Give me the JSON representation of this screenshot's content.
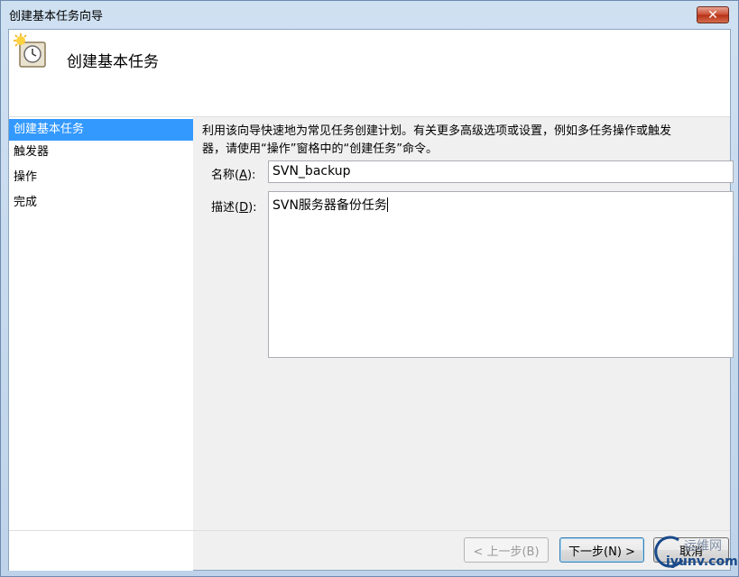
{
  "window": {
    "title": "创建基本任务向导",
    "close_label": "✕"
  },
  "header": {
    "title": "创建基本任务",
    "icon": "task-clock-icon"
  },
  "nav": {
    "items": [
      {
        "label": "创建基本任务",
        "selected": true
      },
      {
        "label": "触发器",
        "selected": false
      },
      {
        "label": "操作",
        "selected": false
      },
      {
        "label": "完成",
        "selected": false
      }
    ]
  },
  "content": {
    "intro_line1": "利用该向导快速地为常见任务创建计划。有关更多高级选项或设置，例如多任务操作或触发",
    "intro_line2": "器，请使用“操作”窗格中的“创建任务”命令。",
    "name_label_pre": "名称(",
    "name_label_key": "A",
    "name_label_post": "):",
    "name_value": "SVN_backup",
    "desc_label_pre": "描述(",
    "desc_label_key": "D",
    "desc_label_post": "):",
    "desc_value": "SVN服务器备份任务"
  },
  "footer": {
    "back_label": "< 上一步(B)",
    "next_label": "下一步(N) >",
    "cancel_label": "取消"
  },
  "watermark": {
    "top": "运维网",
    "bottom": "iyunv.com"
  },
  "colors": {
    "selection": "#3399ff",
    "titlebar": "#cfe0f1",
    "close": "#c74a30"
  }
}
